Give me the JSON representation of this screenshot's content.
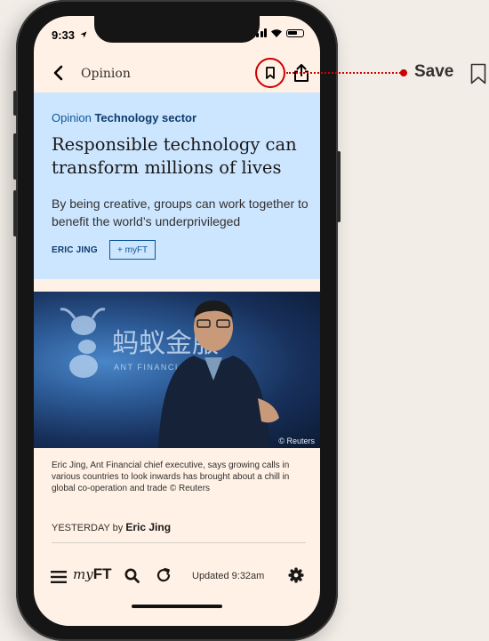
{
  "status": {
    "time": "9:33"
  },
  "nav": {
    "title": "Opinion"
  },
  "article": {
    "topic_prefix": "Opinion",
    "topic": "Technology sector",
    "headline": "Responsible technology can transform millions of lives",
    "standfirst": "By being creative, groups can work together to benefit the world’s underprivileged",
    "author_tag": "ERIC JING",
    "myft_button": "+ myFT",
    "photo_credit": "© Reuters",
    "caption": "Eric Jing, Ant Financial chief executive, says growing calls in various countries to look inwards has brought about a chill in global co-operation and trade © Reuters",
    "byline_prefix": "YESTERDAY by",
    "byline_author": "Eric Jing"
  },
  "toolbar": {
    "myft_prefix": "my",
    "myft_bold": "FT",
    "updated": "Updated 9:32am"
  },
  "annotation": {
    "label": "Save"
  },
  "colors": {
    "accent": "#cc0000",
    "hero_bg": "#cce6ff",
    "page_bg": "#fff1e5",
    "link": "#0f5499"
  }
}
